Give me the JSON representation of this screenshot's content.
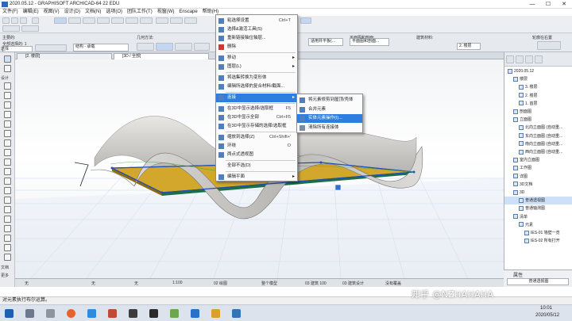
{
  "window": {
    "title": "2020.05.12 - GRAPHISOFT ARCHICAD-64 22 EDU",
    "controls": [
      "—",
      "☐",
      "✕"
    ]
  },
  "menubar": [
    "文件(F)",
    "编辑(E)",
    "视图(V)",
    "设计(D)",
    "文档(N)",
    "选项(O)",
    "团队工作(T)",
    "视窗(W)",
    "Enscape",
    "帮助(H)"
  ],
  "infobar": {
    "main_label": "主要的:",
    "tool_label": "几何方法:",
    "layer_label": "结构 - 承载",
    "all_label": "全部选择的: 1",
    "structure_value": "适用并平板(…",
    "floor_label": "平面图和剖面:",
    "floor_value": "平面图和剖面...",
    "story_label": "建筑材料:",
    "story_value": "2. 楼层",
    "section_label": "轮廓在右置"
  },
  "toolbox": {
    "select_label": "选择",
    "design_label": "设计",
    "document_label": "文档",
    "more_label": "更多"
  },
  "tabs": [
    {
      "label": "[2. 楼层]"
    },
    {
      "label": "[3D / 全部]"
    }
  ],
  "context_menu": {
    "items": [
      {
        "label": "粘选择设置",
        "shortcut": "Ctrl+T",
        "icon": "settings-icon"
      },
      {
        "label": "选择&激活工具(S)",
        "shortcut": "",
        "icon": "pointer-icon"
      },
      {
        "label": "重新链接轴位轴层...",
        "shortcut": "",
        "icon": "link-icon"
      },
      {
        "label": "删除",
        "shortcut": "",
        "icon": "delete-icon"
      },
      {
        "label": "移动",
        "shortcut": "",
        "icon": "move-icon",
        "submenu": true
      },
      {
        "label": "图层(L)",
        "shortcut": "",
        "icon": "layer-icon",
        "submenu": true
      },
      {
        "label": "将选集转换为变形体",
        "shortcut": "",
        "icon": "morph-icon"
      },
      {
        "label": "编辑所选择的复合材料/截面...",
        "shortcut": "",
        "icon": "material-icon"
      },
      {
        "label": "连接",
        "shortcut": "",
        "icon": "connect-icon",
        "submenu": true,
        "highlighted": true
      },
      {
        "label": "在3D中显示选择/选取框",
        "shortcut": "F5",
        "icon": "show-3d-icon"
      },
      {
        "label": "在3D中显示全部",
        "shortcut": "Ctrl+F5",
        "icon": "show-all-3d-icon"
      },
      {
        "label": "在3D中显示存储的选择/选取框",
        "shortcut": "",
        "icon": "stored-3d-icon"
      },
      {
        "label": "缩放到选择(Z)",
        "shortcut": "Ctrl+Shift+'",
        "icon": "zoom-icon"
      },
      {
        "label": "环绕",
        "shortcut": "O",
        "icon": "orbit-icon"
      },
      {
        "label": "两点式透视图",
        "shortcut": "",
        "icon": "perspective-icon"
      },
      {
        "label": "全部不选(D)",
        "shortcut": "",
        "icon": ""
      },
      {
        "label": "编辑平面",
        "shortcut": "",
        "icon": "edit-plane-icon",
        "submenu": true
      }
    ]
  },
  "submenu": {
    "items": [
      {
        "label": "将元素修剪到屋顶/壳体",
        "icon": "trim-icon"
      },
      {
        "label": "合并元素",
        "icon": "merge-icon"
      },
      {
        "label": "实体元素操作(I)...",
        "icon": "solid-ops-icon",
        "highlighted": true
      },
      {
        "label": "清除所有连接体",
        "icon": "clear-icon"
      }
    ]
  },
  "navigator": {
    "tree": [
      {
        "label": "2020.05.12",
        "level": 0
      },
      {
        "label": "楼层",
        "level": 1
      },
      {
        "label": "3. 楼层",
        "level": 2
      },
      {
        "label": "2. 楼层",
        "level": 2
      },
      {
        "label": "1. 首层",
        "level": 2
      },
      {
        "label": "剖面图",
        "level": 1
      },
      {
        "label": "立面图",
        "level": 1
      },
      {
        "label": "北向立面图 (自动重...",
        "level": 2
      },
      {
        "label": "东向立面图 (自动重...",
        "level": 2
      },
      {
        "label": "南向立面图 (自动重...",
        "level": 2
      },
      {
        "label": "西向立面图 (自动重...",
        "level": 2
      },
      {
        "label": "室内立面图",
        "level": 1
      },
      {
        "label": "工作图",
        "level": 1
      },
      {
        "label": "详图",
        "level": 1
      },
      {
        "label": "3D文档",
        "level": 1
      },
      {
        "label": "3D",
        "level": 1
      },
      {
        "label": "普通透视图",
        "level": 2,
        "selected": true
      },
      {
        "label": "普通轴测图",
        "level": 2
      },
      {
        "label": "清单",
        "level": 1
      },
      {
        "label": "元素",
        "level": 2
      },
      {
        "label": "IES-01 墙壁一览",
        "level": 3
      },
      {
        "label": "IES-02 所有打开",
        "level": 3
      }
    ],
    "props_title": "属性",
    "props_value": "普通透视图"
  },
  "viewport_status": {
    "items": [
      "无",
      "无",
      "无",
      "1:100",
      "02 绘图",
      "整个模型",
      "03 建筑 100",
      "03 建筑设计",
      "没有覆盖"
    ]
  },
  "status_text": "对元素执行布尔运算。",
  "taskbar": {
    "time": "10:01",
    "date": "2020/05/12"
  },
  "watermark": "知乎 @NZHAHAHA",
  "colors": {
    "highlight": "#2d7ee0",
    "selection_line": "#1e4fb4",
    "slab_fill": "#d2a72c",
    "surface": "#c8c7c4"
  }
}
